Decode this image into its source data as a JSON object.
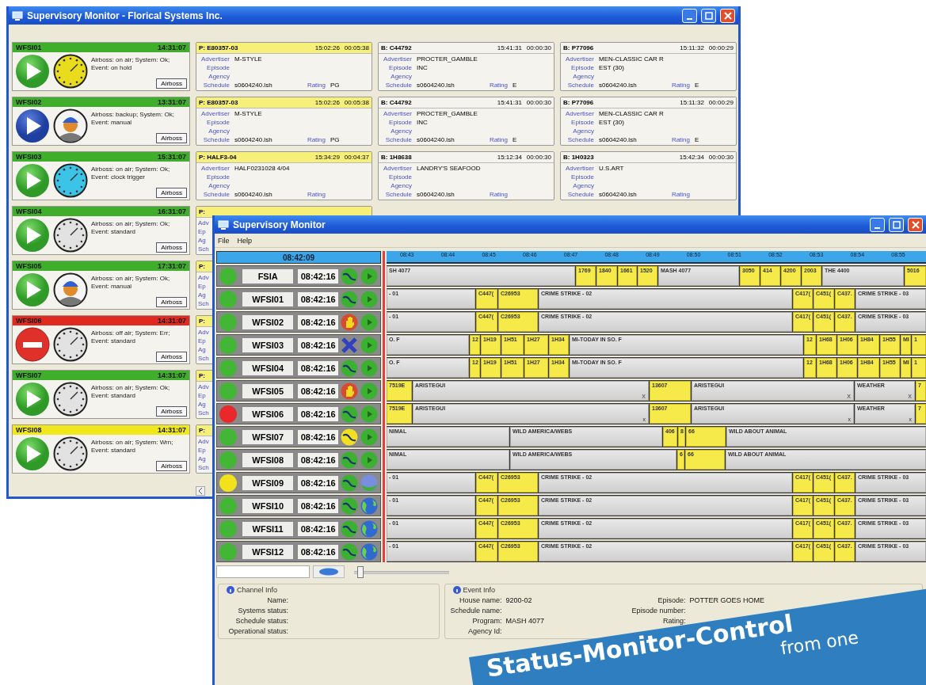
{
  "back_window": {
    "title": "Supervisory Monitor - Florical Systems Inc.",
    "rows": [
      {
        "station": {
          "name": "WFSI01",
          "time": "14:31:07",
          "color": "#3fae2a",
          "status_icon": {
            "kind": "play"
          },
          "indicator": {
            "kind": "clock",
            "color": "#e8dc1c"
          },
          "lines": [
            "Airboss: on air; System: Ok;",
            "Event: on hold"
          ],
          "button": "Airboss"
        },
        "events": [
          {
            "kind": "program",
            "id": "P: E80357-03",
            "time": "15:02:26",
            "duration": "00:05:38",
            "fields": [
              {
                "label": "Advertiser",
                "value": "M-STYLE"
              },
              {
                "label": "Episode"
              },
              {
                "label": "Agency"
              },
              {
                "label": "Schedule",
                "value": "s0604240.lsh"
              }
            ],
            "rating": {
              "label": "Rating",
              "value": "PG"
            }
          },
          {
            "kind": "break",
            "id": "B: C44792",
            "time": "15:41:31",
            "duration": "00:00:30",
            "fields": [
              {
                "label": "Advertiser",
                "value": "PROCTER_GAMBLE"
              },
              {
                "label": "Episode",
                "value": "INC"
              },
              {
                "label": "Agency"
              },
              {
                "label": "Schedule",
                "value": "s0604240.lsh"
              }
            ],
            "rating": {
              "label": "Rating",
              "value": "E"
            }
          },
          {
            "kind": "break",
            "id": "B: P77096",
            "time": "15:11:32",
            "duration": "00:00:29",
            "fields": [
              {
                "label": "Advertiser",
                "value": "MEN-CLASSIC CAR R"
              },
              {
                "label": "Episode",
                "value": "EST (30)"
              },
              {
                "label": "Agency"
              },
              {
                "label": "Schedule",
                "value": "s0604240.lsh"
              }
            ],
            "rating": {
              "label": "Rating",
              "value": "E"
            }
          }
        ]
      },
      {
        "station": {
          "name": "WFSI02",
          "time": "13:31:07",
          "color": "#3fae2a",
          "status_icon": {
            "kind": "backup"
          },
          "indicator": {
            "kind": "operator"
          },
          "lines": [
            "Airboss: backup; System: Ok;",
            "Event: manual"
          ],
          "button": "Airboss"
        },
        "events": [
          {
            "kind": "program",
            "id": "P: E80357-03",
            "time": "15:02:26",
            "duration": "00:05:38",
            "fields": [
              {
                "label": "Advertiser",
                "value": "M-STYLE"
              },
              {
                "label": "Episode"
              },
              {
                "label": "Agency"
              },
              {
                "label": "Schedule",
                "value": "s0604240.lsh"
              }
            ],
            "rating": {
              "label": "Rating",
              "value": "PG"
            }
          },
          {
            "kind": "break",
            "id": "B: C44792",
            "time": "15:41:31",
            "duration": "00:00:30",
            "fields": [
              {
                "label": "Advertiser",
                "value": "PROCTER_GAMBLE"
              },
              {
                "label": "Episode",
                "value": "INC"
              },
              {
                "label": "Agency"
              },
              {
                "label": "Schedule",
                "value": "s0604240.lsh"
              }
            ],
            "rating": {
              "label": "Rating",
              "value": "E"
            }
          },
          {
            "kind": "break",
            "id": "B: P77096",
            "time": "15:11:32",
            "duration": "00:00:29",
            "fields": [
              {
                "label": "Advertiser",
                "value": "MEN-CLASSIC CAR R"
              },
              {
                "label": "Episode",
                "value": "EST (30)"
              },
              {
                "label": "Agency"
              },
              {
                "label": "Schedule",
                "value": "s0604240.lsh"
              }
            ],
            "rating": {
              "label": "Rating",
              "value": "E"
            }
          }
        ]
      },
      {
        "station": {
          "name": "WFSI03",
          "time": "15:31:07",
          "color": "#3fae2a",
          "status_icon": {
            "kind": "play"
          },
          "indicator": {
            "kind": "clock",
            "color": "#3cc4e8"
          },
          "lines": [
            "Airboss: on air; System: Ok;",
            "Event: clock trigger"
          ],
          "button": "Airboss"
        },
        "events": [
          {
            "kind": "program",
            "id": "P: HALF3-04",
            "time": "15:34:29",
            "duration": "00:04:37",
            "fields": [
              {
                "label": "Advertiser",
                "value": "HALF0231028 4/04"
              },
              {
                "label": "Episode"
              },
              {
                "label": "Agency"
              },
              {
                "label": "Schedule",
                "value": "s0604240.lsh"
              }
            ],
            "rating": {
              "label": "Rating"
            }
          },
          {
            "kind": "break",
            "id": "B: 1H8638",
            "time": "15:12:34",
            "duration": "00:00:30",
            "fields": [
              {
                "label": "Advertiser",
                "value": "LANDRY'S SEAFOOD"
              },
              {
                "label": "Episode"
              },
              {
                "label": "Agency"
              },
              {
                "label": "Schedule",
                "value": "s0604240.lsh"
              }
            ],
            "rating": {
              "label": "Rating"
            }
          },
          {
            "kind": "break",
            "id": "B: 1H0323",
            "time": "15:42:34",
            "duration": "00:00:30",
            "fields": [
              {
                "label": "Advertiser",
                "value": "U.S.ART"
              },
              {
                "label": "Episode"
              },
              {
                "label": "Agency"
              },
              {
                "label": "Schedule",
                "value": "s0604240.lsh"
              }
            ],
            "rating": {
              "label": "Rating"
            }
          }
        ]
      },
      {
        "station": {
          "name": "WFSI04",
          "time": "16:31:07",
          "color": "#3fae2a",
          "status_icon": {
            "kind": "play"
          },
          "indicator": {
            "kind": "clock",
            "color": "#e2e2e2"
          },
          "lines": [
            "Airboss: on air; System: Ok;",
            "Event: standard"
          ],
          "button": "Airboss"
        },
        "events": [
          {
            "kind": "program",
            "id": "P:",
            "fields": [
              {
                "label": "Adv"
              },
              {
                "label": "Ep"
              },
              {
                "label": "Ag"
              },
              {
                "label": "Sch"
              }
            ]
          }
        ]
      },
      {
        "station": {
          "name": "WFSI05",
          "time": "17:31:07",
          "color": "#3fae2a",
          "status_icon": {
            "kind": "play"
          },
          "indicator": {
            "kind": "operator"
          },
          "lines": [
            "Airboss: on air; System: Ok;",
            "Event: manual"
          ],
          "button": "Airboss"
        },
        "events": [
          {
            "kind": "program",
            "id": "P:",
            "fields": [
              {
                "label": "Adv"
              },
              {
                "label": "Ep"
              },
              {
                "label": "Ag"
              },
              {
                "label": "Sch"
              }
            ]
          }
        ]
      },
      {
        "station": {
          "name": "WFSI06",
          "time": "14:31:07",
          "color": "#e02a20",
          "status_icon": {
            "kind": "stop"
          },
          "indicator": {
            "kind": "clock",
            "color": "#e2e2e2"
          },
          "lines": [
            "Airboss: off air; System: Err;",
            "Event: standard"
          ],
          "button": "Airboss"
        },
        "events": [
          {
            "kind": "program",
            "id": "P:",
            "fields": [
              {
                "label": "Adv"
              },
              {
                "label": "Ep"
              },
              {
                "label": "Ag"
              },
              {
                "label": "Sch"
              }
            ]
          }
        ]
      },
      {
        "station": {
          "name": "WFSI07",
          "time": "14:31:07",
          "color": "#3fae2a",
          "status_icon": {
            "kind": "play"
          },
          "indicator": {
            "kind": "clock",
            "color": "#e2e2e2"
          },
          "lines": [
            "Airboss: on air; System: Ok;",
            "Event: standard"
          ],
          "button": "Airboss"
        },
        "events": [
          {
            "kind": "program",
            "id": "P:",
            "fields": [
              {
                "label": "Adv"
              },
              {
                "label": "Ep"
              },
              {
                "label": "Ag"
              },
              {
                "label": "Sch"
              }
            ]
          }
        ]
      },
      {
        "station": {
          "name": "WFSI08",
          "time": "14:31:07",
          "color": "#f0e81c",
          "status_icon": {
            "kind": "play"
          },
          "indicator": {
            "kind": "clock",
            "color": "#e2e2e2"
          },
          "lines": [
            "Airboss: on air; System: Wrn;",
            "Event: standard"
          ],
          "button": "Airboss"
        },
        "events": [
          {
            "kind": "program",
            "id": "P:",
            "fields": [
              {
                "label": "Adv"
              },
              {
                "label": "Ep"
              },
              {
                "label": "Ag"
              },
              {
                "label": "Sch"
              }
            ]
          }
        ]
      }
    ]
  },
  "front_window": {
    "title": "Supervisory Monitor",
    "menu": [
      "File",
      "Help"
    ],
    "clock": "08:42:09",
    "ticks": [
      "08:43",
      "08:44",
      "08:45",
      "08:46",
      "08:47",
      "08:48",
      "08:49",
      "08:50",
      "08:51",
      "08:52",
      "08:53",
      "08:54",
      "08:55"
    ],
    "stations": [
      {
        "name": "FSIA",
        "time": "08:42:16",
        "color": "#44b636",
        "state_icon": {
          "kind": "wave"
        },
        "feed_icon": {
          "kind": "play"
        },
        "segments": [
          {
            "kind": "program",
            "text": "SH 4077"
          },
          {
            "kind": "break",
            "text": "1769"
          },
          {
            "kind": "break",
            "text": "1840"
          },
          {
            "kind": "break",
            "text": "1661"
          },
          {
            "kind": "break",
            "text": "1520"
          },
          {
            "kind": "program",
            "text": "MASH 4077"
          },
          {
            "kind": "break",
            "text": "3050"
          },
          {
            "kind": "break",
            "text": "414"
          },
          {
            "kind": "break",
            "text": "4200"
          },
          {
            "kind": "break",
            "text": "2003"
          },
          {
            "kind": "program",
            "text": "THE 4400"
          },
          {
            "kind": "break",
            "text": "5016"
          }
        ]
      },
      {
        "name": "WFSI01",
        "time": "08:42:16",
        "color": "#44b636",
        "state_icon": {
          "kind": "wave"
        },
        "feed_icon": {
          "kind": "play"
        },
        "segments": [
          {
            "kind": "program",
            "text": "- 01"
          },
          {
            "kind": "break",
            "text": "C447("
          },
          {
            "kind": "break",
            "text": "C26953"
          },
          {
            "kind": "program",
            "text": "CRIME STRIKE - 02"
          },
          {
            "kind": "break",
            "text": "C417("
          },
          {
            "kind": "break",
            "text": "C451("
          },
          {
            "kind": "break",
            "text": "C437."
          },
          {
            "kind": "program",
            "text": "CRIME STRIKE - 03"
          }
        ]
      },
      {
        "name": "WFSI02",
        "time": "08:42:16",
        "color": "#44b636",
        "state_icon": {
          "kind": "hand"
        },
        "feed_icon": {
          "kind": "play"
        },
        "segments": [
          {
            "kind": "program",
            "text": "- 01"
          },
          {
            "kind": "break",
            "text": "C447("
          },
          {
            "kind": "break",
            "text": "C26953"
          },
          {
            "kind": "program",
            "text": "CRIME STRIKE - 02"
          },
          {
            "kind": "break",
            "text": "C417("
          },
          {
            "kind": "break",
            "text": "C451("
          },
          {
            "kind": "break",
            "text": "C437."
          },
          {
            "kind": "program",
            "text": "CRIME STRIKE - 03"
          }
        ]
      },
      {
        "name": "WFSI03",
        "time": "08:42:16",
        "color": "#44b636",
        "state_icon": {
          "kind": "cross"
        },
        "feed_icon": {
          "kind": "play"
        },
        "segments": [
          {
            "kind": "program",
            "text": "O. F"
          },
          {
            "kind": "break",
            "text": "12"
          },
          {
            "kind": "break",
            "text": "1H19"
          },
          {
            "kind": "break",
            "text": "1H51"
          },
          {
            "kind": "break",
            "text": "1H27"
          },
          {
            "kind": "break",
            "text": "1H34"
          },
          {
            "kind": "program",
            "text": "MI-TODAY IN SO. F"
          },
          {
            "kind": "break",
            "text": "12"
          },
          {
            "kind": "break",
            "text": "1H68"
          },
          {
            "kind": "break",
            "text": "1H06"
          },
          {
            "kind": "break",
            "text": "1H84"
          },
          {
            "kind": "break",
            "text": "1H55"
          },
          {
            "kind": "break",
            "text": "MI"
          },
          {
            "kind": "break",
            "text": "1"
          }
        ]
      },
      {
        "name": "WFSI04",
        "time": "08:42:16",
        "color": "#44b636",
        "state_icon": {
          "kind": "wave"
        },
        "feed_icon": {
          "kind": "play"
        },
        "segments": [
          {
            "kind": "program",
            "text": "O. F"
          },
          {
            "kind": "break",
            "text": "12"
          },
          {
            "kind": "break",
            "text": "1H19"
          },
          {
            "kind": "break",
            "text": "1H51"
          },
          {
            "kind": "break",
            "text": "1H27"
          },
          {
            "kind": "break",
            "text": "1H34"
          },
          {
            "kind": "program",
            "text": "MI-TODAY IN SO. F"
          },
          {
            "kind": "break",
            "text": "12"
          },
          {
            "kind": "break",
            "text": "1H68"
          },
          {
            "kind": "break",
            "text": "1H06"
          },
          {
            "kind": "break",
            "text": "1H84"
          },
          {
            "kind": "break",
            "text": "1H55"
          },
          {
            "kind": "break",
            "text": "MI"
          },
          {
            "kind": "break",
            "text": "1"
          }
        ]
      },
      {
        "name": "WFSI05",
        "time": "08:42:16",
        "color": "#44b636",
        "state_icon": {
          "kind": "hand"
        },
        "feed_icon": {
          "kind": "play"
        },
        "segments": [
          {
            "kind": "break",
            "text": "7519E"
          },
          {
            "kind": "program",
            "text": "ARISTEGUI",
            "mark": "X"
          },
          {
            "kind": "break",
            "text": "13607"
          },
          {
            "kind": "program",
            "text": "ARISTEGUI",
            "mark": "X"
          },
          {
            "kind": "program",
            "text": "WEATHER",
            "mark": "X"
          },
          {
            "kind": "break",
            "text": "7"
          }
        ]
      },
      {
        "name": "WFSI06",
        "time": "08:42:16",
        "color": "#e8282a",
        "state_icon": {
          "kind": "wave"
        },
        "feed_icon": {
          "kind": "play"
        },
        "segments": [
          {
            "kind": "break",
            "text": "7519E"
          },
          {
            "kind": "program",
            "text": "ARISTEGUI",
            "mark": "x"
          },
          {
            "kind": "break",
            "text": "13607"
          },
          {
            "kind": "program",
            "text": "ARISTEGUI",
            "mark": "x"
          },
          {
            "kind": "program",
            "text": "WEATHER",
            "mark": "x"
          },
          {
            "kind": "break",
            "text": "7"
          }
        ]
      },
      {
        "name": "WFSI07",
        "time": "08:42:16",
        "color": "#44b636",
        "state_icon": {
          "kind": "caution"
        },
        "feed_icon": {
          "kind": "play"
        },
        "segments": [
          {
            "kind": "program",
            "text": "NIMAL"
          },
          {
            "kind": "program",
            "text": "WILD AMERICA/WEBS"
          },
          {
            "kind": "break",
            "text": "406"
          },
          {
            "kind": "break",
            "text": "8"
          },
          {
            "kind": "break",
            "text": "66"
          },
          {
            "kind": "program",
            "text": "WILD ABOUT ANIMAL"
          }
        ]
      },
      {
        "name": "WFSI08",
        "time": "08:42:16",
        "color": "#44b636",
        "state_icon": {
          "kind": "wave"
        },
        "feed_icon": {
          "kind": "play"
        },
        "segments": [
          {
            "kind": "program",
            "text": "NIMAL"
          },
          {
            "kind": "program",
            "text": "WILD AMERICA/WEBS"
          },
          {
            "kind": "break",
            "text": "6"
          },
          {
            "kind": "break",
            "text": "66"
          },
          {
            "kind": "program",
            "text": "WILD ABOUT ANIMAL"
          }
        ]
      },
      {
        "name": "WFSI09",
        "time": "08:42:16",
        "color": "#f2e21c",
        "state_icon": {
          "kind": "wave"
        },
        "feed_icon": {
          "kind": "sphere"
        },
        "segments": [
          {
            "kind": "program",
            "text": "- 01"
          },
          {
            "kind": "break",
            "text": "C447("
          },
          {
            "kind": "break",
            "text": "C26953"
          },
          {
            "kind": "program",
            "text": "CRIME STRIKE - 02"
          },
          {
            "kind": "break",
            "text": "C417("
          },
          {
            "kind": "break",
            "text": "C451("
          },
          {
            "kind": "break",
            "text": "C437."
          },
          {
            "kind": "program",
            "text": "CRIME STRIKE - 03"
          }
        ]
      },
      {
        "name": "WFSI10",
        "time": "08:42:16",
        "color": "#44b636",
        "state_icon": {
          "kind": "wave"
        },
        "feed_icon": {
          "kind": "globe"
        },
        "segments": [
          {
            "kind": "program",
            "text": "- 01"
          },
          {
            "kind": "break",
            "text": "C447("
          },
          {
            "kind": "break",
            "text": "C26953"
          },
          {
            "kind": "program",
            "text": "CRIME STRIKE - 02"
          },
          {
            "kind": "break",
            "text": "C417("
          },
          {
            "kind": "break",
            "text": "C451("
          },
          {
            "kind": "break",
            "text": "C437."
          },
          {
            "kind": "program",
            "text": "CRIME STRIKE - 03"
          }
        ]
      },
      {
        "name": "WFSI11",
        "time": "08:42:16",
        "color": "#44b636",
        "state_icon": {
          "kind": "wave"
        },
        "feed_icon": {
          "kind": "globe"
        },
        "segments": [
          {
            "kind": "program",
            "text": "- 01"
          },
          {
            "kind": "break",
            "text": "C447("
          },
          {
            "kind": "break",
            "text": "C26953"
          },
          {
            "kind": "program",
            "text": "CRIME STRIKE - 02"
          },
          {
            "kind": "break",
            "text": "C417("
          },
          {
            "kind": "break",
            "text": "C451("
          },
          {
            "kind": "break",
            "text": "C437."
          },
          {
            "kind": "program",
            "text": "CRIME STRIKE - 03"
          }
        ]
      },
      {
        "name": "WFSI12",
        "time": "08:42:16",
        "color": "#44b636",
        "state_icon": {
          "kind": "wave"
        },
        "feed_icon": {
          "kind": "globe"
        },
        "segments": [
          {
            "kind": "program",
            "text": "- 01"
          },
          {
            "kind": "break",
            "text": "C447("
          },
          {
            "kind": "break",
            "text": "C26953"
          },
          {
            "kind": "program",
            "text": "CRIME STRIKE - 02"
          },
          {
            "kind": "break",
            "text": "C417("
          },
          {
            "kind": "break",
            "text": "C451("
          },
          {
            "kind": "break",
            "text": "C437."
          },
          {
            "kind": "program",
            "text": "CRIME STRIKE - 03"
          }
        ]
      }
    ],
    "zoom": {
      "level": 0.03
    },
    "channel_info": {
      "title": "Channel Info",
      "fields": [
        {
          "label": "Name:"
        },
        {
          "label": "Systems status:"
        },
        {
          "label": "Schedule status:"
        },
        {
          "label": "Operational status:"
        }
      ]
    },
    "event_info": {
      "title": "Event Info",
      "left": [
        {
          "label": "House name:",
          "value": "9200-02"
        },
        {
          "label": "Schedule name:"
        },
        {
          "label": "Program:",
          "value": "MASH 4077"
        },
        {
          "label": "Agency Id:"
        }
      ],
      "right": [
        {
          "label": "Episode:",
          "value": "POTTER GOES HOME"
        },
        {
          "label": "Episode number:"
        },
        {
          "label": "Rating:"
        }
      ]
    }
  },
  "banner": {
    "title": "Status-Monitor-Control",
    "subtitle": "from one"
  }
}
